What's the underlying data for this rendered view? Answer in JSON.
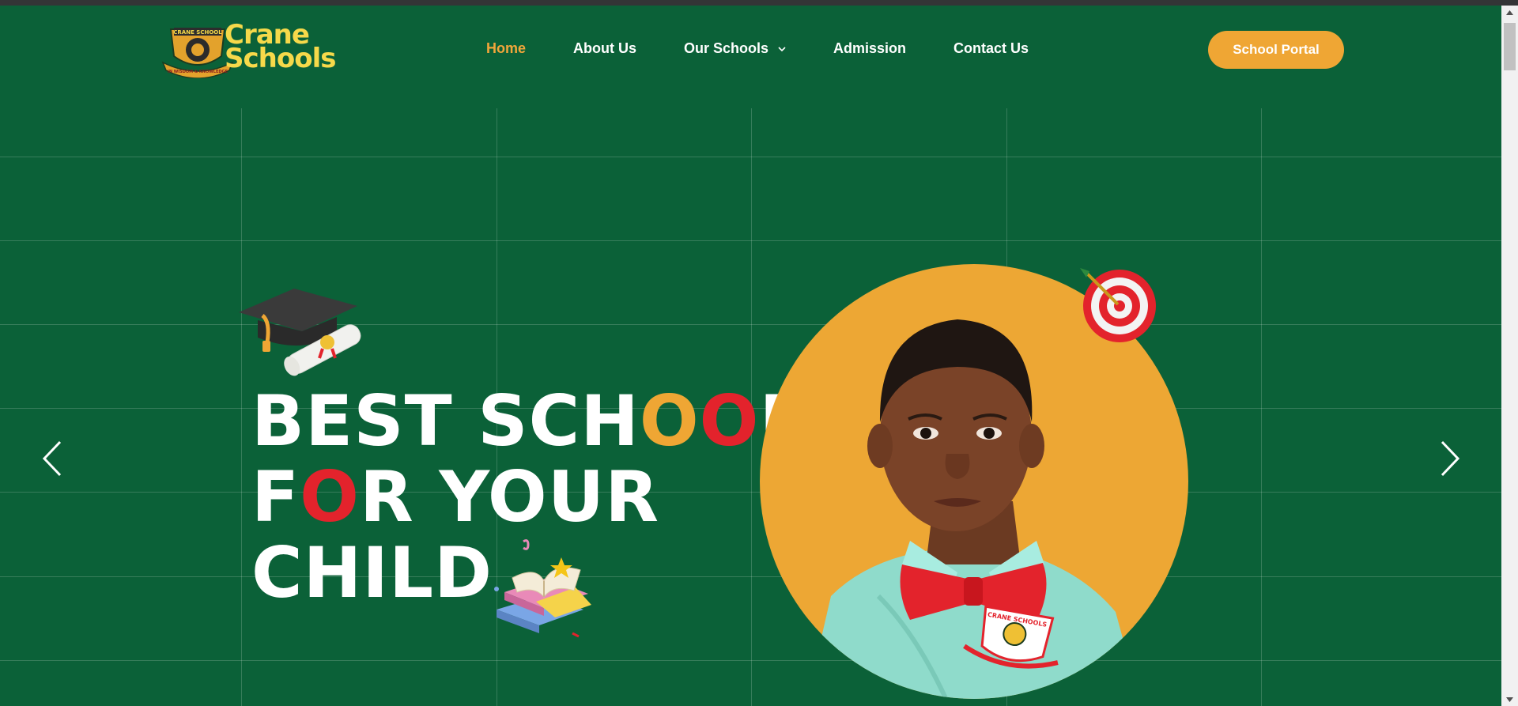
{
  "brand": {
    "name_line1": "Crane",
    "name_line2": "Schools",
    "crest_banner": "CRANE SCHOOL",
    "crest_motto": "IN WISDOM & KNOWLEDGE"
  },
  "nav": {
    "items": [
      {
        "label": "Home",
        "active": true
      },
      {
        "label": "About Us",
        "active": false
      },
      {
        "label": "Our Schools",
        "active": false,
        "has_dropdown": true
      },
      {
        "label": "Admission",
        "active": false
      },
      {
        "label": "Contact Us",
        "active": false
      }
    ]
  },
  "header": {
    "portal_label": "School Portal"
  },
  "hero": {
    "line1_a": "BEST SCH",
    "line1_o1": "O",
    "line1_o2": "O",
    "line1_b": "L",
    "line2_a": "F",
    "line2_o": "O",
    "line2_b": "R YOUR",
    "line3": "CHILD"
  },
  "badge": {
    "text": "CRANE SCHOOLS"
  },
  "icons": {
    "prev": "chevron-left-icon",
    "next": "chevron-right-icon",
    "dropdown": "chevron-down-icon",
    "cap": "graduation-cap-icon",
    "books": "books-icon",
    "target": "target-icon"
  },
  "colors": {
    "background": "#0b6138",
    "accent_orange": "#efa634",
    "accent_red": "#e3232c",
    "logo_yellow": "#f6d94a"
  }
}
